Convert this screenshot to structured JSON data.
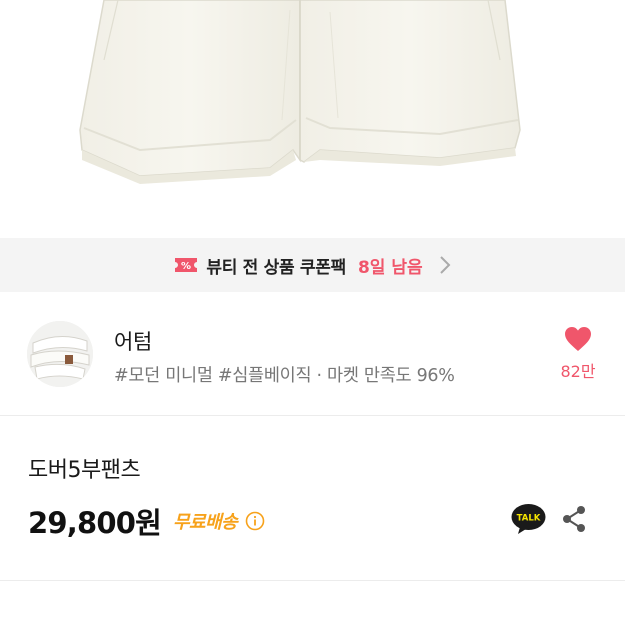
{
  "coupon_banner": {
    "text": "뷰티 전 상품 쿠폰팩",
    "remaining": "8일 남음",
    "accent_color": "#f0566b",
    "icon": "coupon-ticket-icon"
  },
  "store": {
    "name": "어텀",
    "tags": "#모던 미니멀 #심플베이직 · 마켓 만족도 96%",
    "like_count": "82만",
    "avatar_icon": "store-avatar"
  },
  "product": {
    "name": "도버5부팬츠",
    "price": "29,800원",
    "shipping": "무료배송",
    "shipping_color": "#f7a21b"
  },
  "actions": {
    "talk_label": "TALK",
    "share_icon": "share-icon"
  },
  "bottom_row": {
    "left_text": "",
    "discount": "",
    "price": ""
  }
}
